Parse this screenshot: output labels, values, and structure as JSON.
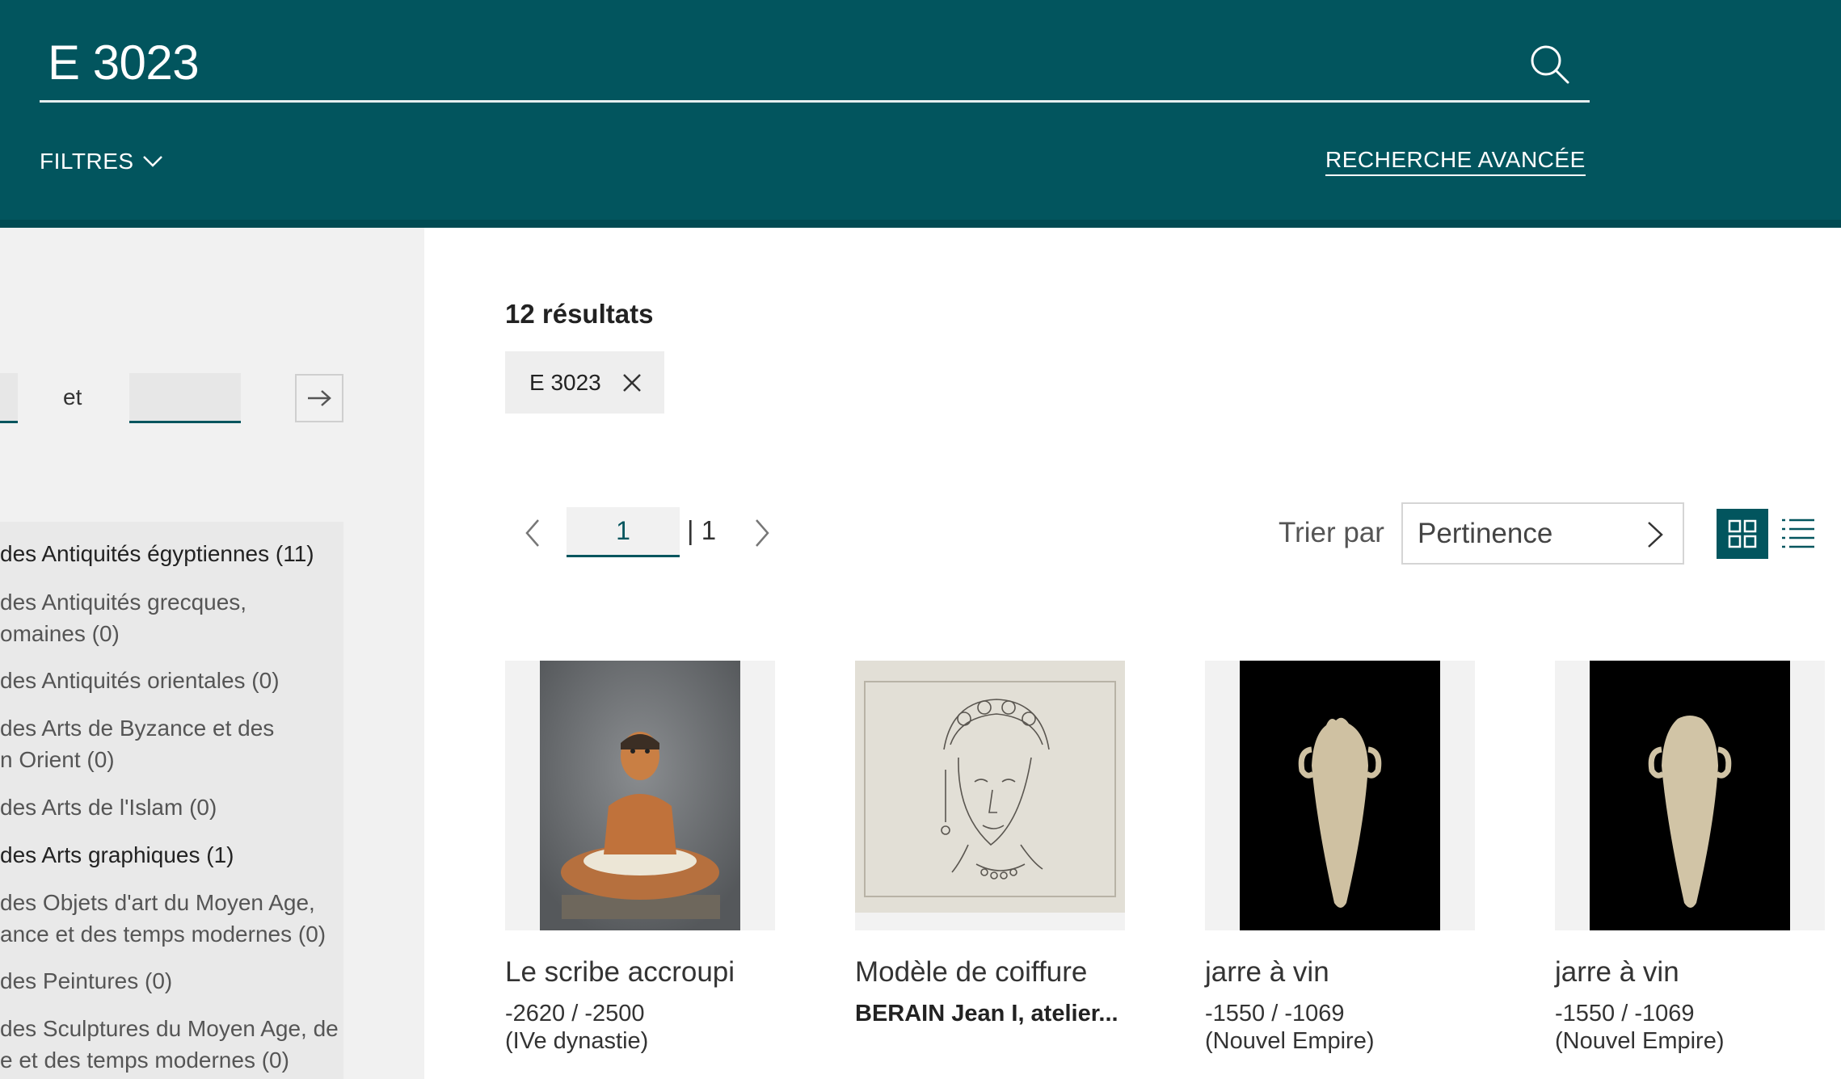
{
  "search": {
    "query": "E 3023"
  },
  "header": {
    "filters_label": "FILTRES",
    "advanced_label": "RECHERCHE AVANCÉE"
  },
  "sidebar": {
    "range_and": "et",
    "facets": [
      {
        "label": "des Antiquités égyptiennes (11)",
        "active": true
      },
      {
        "label": "des Antiquités grecques,",
        "label2": "omaines (0)",
        "active": false
      },
      {
        "label": "des Antiquités orientales (0)",
        "active": false
      },
      {
        "label": "des Arts de Byzance et des",
        "label2": "n Orient (0)",
        "active": false
      },
      {
        "label": "des Arts de l'Islam (0)",
        "active": false
      },
      {
        "label": "des Arts graphiques (1)",
        "active": true
      },
      {
        "label": "des Objets d'art du Moyen Age,",
        "label2": "ance et des temps modernes (0)",
        "active": false
      },
      {
        "label": "des Peintures (0)",
        "active": false
      },
      {
        "label": "des Sculptures du Moyen Age, de",
        "label2": "e et des temps modernes (0)",
        "active": false
      }
    ]
  },
  "results": {
    "count_label": "12 résultats",
    "chip_label": "E 3023",
    "page_current": "1",
    "page_total": "| 1",
    "sort_label": "Trier par",
    "sort_value": "Pertinence"
  },
  "cards": [
    {
      "title": "Le scribe accroupi",
      "line1": "-2620 / -2500",
      "line2": "(IVe dynastie)"
    },
    {
      "title": "Modèle de coiffure",
      "line1": "BERAIN Jean I, atelier...",
      "line2": ""
    },
    {
      "title": "jarre à vin",
      "line1": "-1550 / -1069",
      "line2": "(Nouvel Empire)"
    },
    {
      "title": "jarre à vin",
      "line1": "-1550 / -1069",
      "line2": "(Nouvel Empire)"
    }
  ],
  "icons": {
    "search": "search-icon",
    "filters_chevron": "chevron-down-icon",
    "range_go": "arrow-right-icon",
    "chip_remove": "close-icon",
    "prev": "chevron-left-icon",
    "next": "chevron-right-icon",
    "sort_chevron": "chevron-right-icon",
    "grid_view": "grid-view-icon",
    "list_view": "list-view-icon"
  },
  "colors": {
    "brand": "#02555e",
    "sidebar_bg": "#f1f1f1",
    "facet_panel_bg": "#e9e9e9"
  }
}
